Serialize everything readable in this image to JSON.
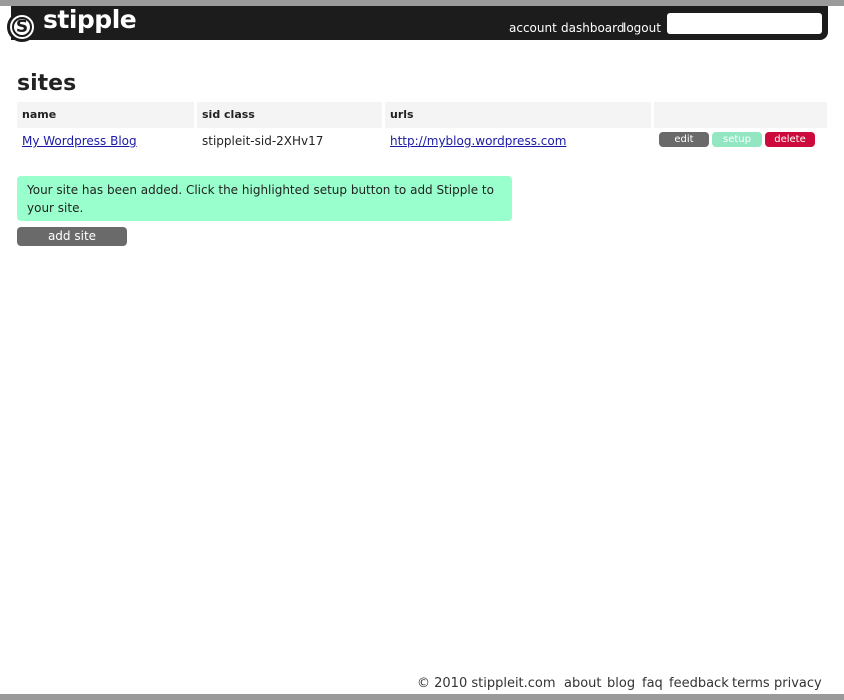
{
  "header": {
    "logo_text": "stipple",
    "logo_letter": "S",
    "nav": {
      "account": "account",
      "dashboard": "dashboard",
      "logout": "logout"
    },
    "search": {
      "value": "",
      "placeholder": ""
    }
  },
  "page": {
    "title": "sites",
    "table": {
      "headers": [
        "name",
        "sid class",
        "urls",
        ""
      ],
      "rows": [
        {
          "name": "My Wordpress Blog",
          "sid_class": "stippleit-sid-2XHv17",
          "url": "http://myblog.wordpress.com",
          "actions": {
            "edit": "edit",
            "setup": "setup",
            "delete": "delete"
          }
        }
      ]
    },
    "notice": "Your site has been added. Click the highlighted setup button to add Stipple to your site.",
    "add_site_label": "add site"
  },
  "footer": {
    "copyright": "© 2010 stippleit.com",
    "links": [
      "about",
      "blog",
      "faq",
      "feedback",
      "terms",
      "privacy"
    ]
  },
  "colors": {
    "header_bg": "#1c1c1c",
    "link": "#1a1aa6",
    "notice_bg": "#99ffcc",
    "edit_btn": "#6a6a6a",
    "setup_btn": "#92e6c2",
    "delete_btn": "#cc0a3c"
  }
}
